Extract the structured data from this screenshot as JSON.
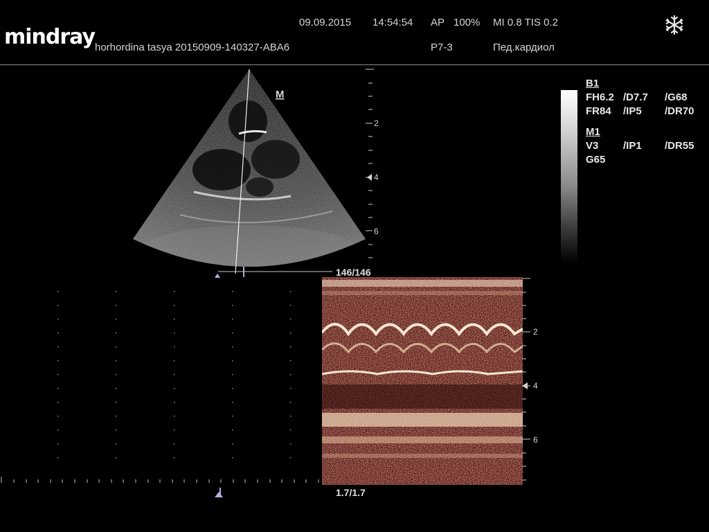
{
  "header": {
    "brand": "mindray",
    "patient": "horhordina tasya 20150909-140327-ABA6",
    "date": "09.09.2015",
    "time": "14:54:54",
    "ap": "AP",
    "ap_value": "100%",
    "mi_tis": "MI 0.8 TIS 0.2",
    "probe": "P7-3",
    "preset": "Пед.кардиол"
  },
  "params": {
    "b1": {
      "title": "B1",
      "row1": [
        "FH6.2",
        "/D7.7",
        "/G68"
      ],
      "row2": [
        "FR84",
        "/IP5",
        "/DR70"
      ]
    },
    "m1": {
      "title": "M1",
      "row1": [
        "V3",
        "/IP1",
        "/DR55"
      ],
      "row2": [
        "G65"
      ]
    }
  },
  "bmode": {
    "marker": "M",
    "depth_labels": [
      "2",
      "4",
      "6"
    ],
    "frame_counter": "146/146"
  },
  "mmode": {
    "depth_labels": [
      "2",
      "4",
      "6"
    ],
    "cine_counter": "1.7/1.7"
  },
  "icons": {
    "freeze": "snowflake-icon",
    "sector": "sector-image",
    "mmode": "mmode-trace-image"
  }
}
